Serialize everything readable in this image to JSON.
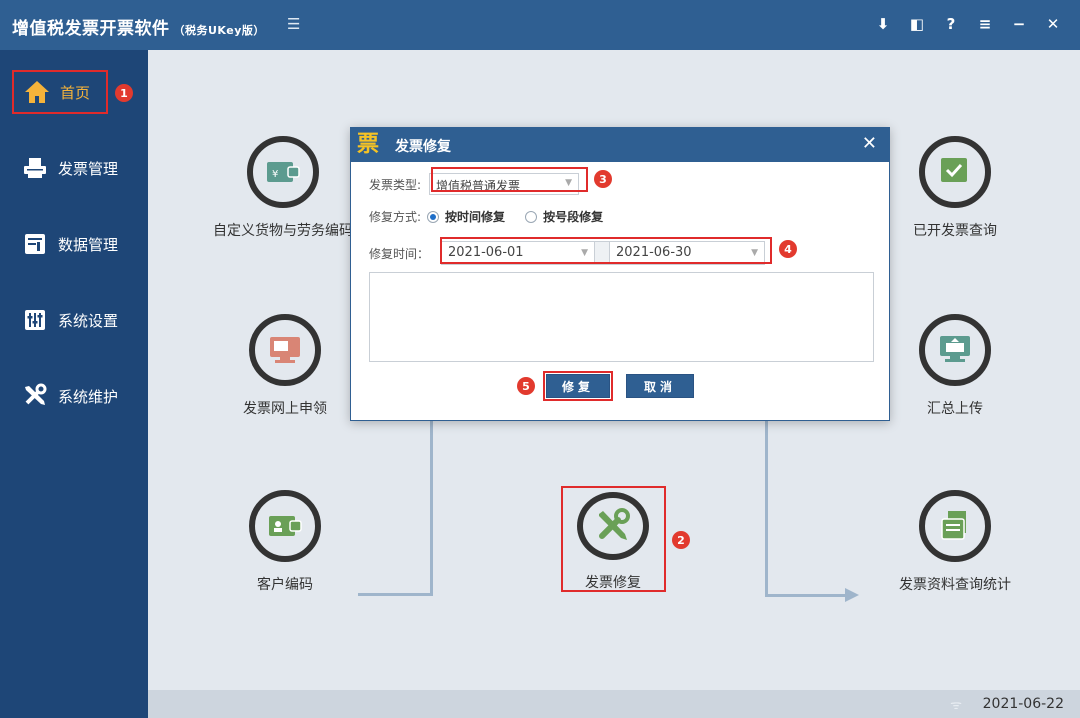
{
  "app": {
    "title": "增值税发票开票软件",
    "subtitle": "（税务UKey版）"
  },
  "sidebar": {
    "items": [
      {
        "label": "首页",
        "icon": "home-icon"
      },
      {
        "label": "发票管理",
        "icon": "printer-icon"
      },
      {
        "label": "数据管理",
        "icon": "data-icon"
      },
      {
        "label": "系统设置",
        "icon": "settings-sliders-icon"
      },
      {
        "label": "系统维护",
        "icon": "tools-icon"
      }
    ]
  },
  "tiles": [
    {
      "label": "自定义货物与劳务编码"
    },
    {
      "label": "发票网上申领"
    },
    {
      "label": "客户编码"
    },
    {
      "label": "发票修复"
    },
    {
      "label": "已开发票查询"
    },
    {
      "label": "汇总上传"
    },
    {
      "label": "发票资料查询统计"
    }
  ],
  "dialog": {
    "logo": "票",
    "title": "发票修复",
    "invoice_type_label": "发票类型:",
    "invoice_type_value": "增值税普通发票",
    "repair_mode_label": "修复方式:",
    "mode_time": "按时间修复",
    "mode_segment": "按号段修复",
    "repair_time_label": "修复时间：",
    "start_date": "2021-06-01",
    "end_date": "2021-06-30",
    "repair_button": "修复",
    "cancel_button": "取消"
  },
  "badges": [
    "1",
    "2",
    "3",
    "4",
    "5"
  ],
  "status": {
    "date": "2021-06-22"
  },
  "colors": {
    "titlebar": "#2f5f92",
    "sidebar": "#1e4677",
    "annotation": "#e02b2b",
    "active": "#f5b33a"
  }
}
